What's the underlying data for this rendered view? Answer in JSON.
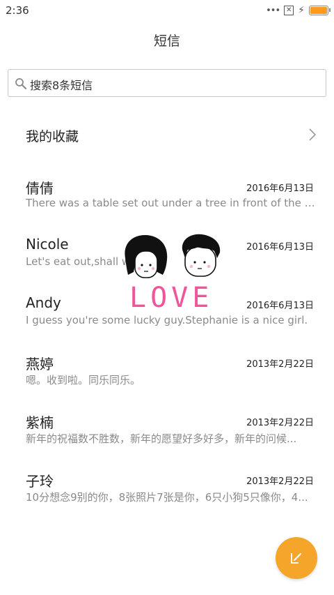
{
  "status_bar": {
    "time": "2:36",
    "dots": "•••",
    "sim_indicator": "✕",
    "charging_icon": "bolt-icon",
    "battery_color": "#ff9a1a"
  },
  "header": {
    "title": "短信"
  },
  "search": {
    "placeholder": "搜索8条短信",
    "icon": "search-icon"
  },
  "favorites": {
    "label": "我的收藏",
    "icon": "chevron-right-icon"
  },
  "conversations": [
    {
      "name": "倩倩",
      "date": "2016年6月13日",
      "preview": "There was a table set out under a tree in front of the ho..."
    },
    {
      "name": "Nicole",
      "date": "2016年6月13日",
      "preview": "Let's eat out,shall we?"
    },
    {
      "name": "Andy",
      "date": "2016年6月13日",
      "preview": "I guess you're some lucky guy.Stephanie is a nice girl."
    },
    {
      "name": "燕婷",
      "date": "2013年2月22日",
      "preview": "嗯。收到啦。同乐同乐。"
    },
    {
      "name": "紫楠",
      "date": "2013年2月22日",
      "preview": "新年的祝福数不胜数，新年的愿望好多好多，新年的问候..."
    },
    {
      "name": "子玲",
      "date": "2013年2月22日",
      "preview": "10分想念9别的你，8张照片7张是你，6只小狗5只像你，4..."
    }
  ],
  "sticker": {
    "text": "LOVE",
    "color": "#f0549a"
  },
  "fab": {
    "icon": "compose-icon",
    "color": "#f5a62a"
  }
}
